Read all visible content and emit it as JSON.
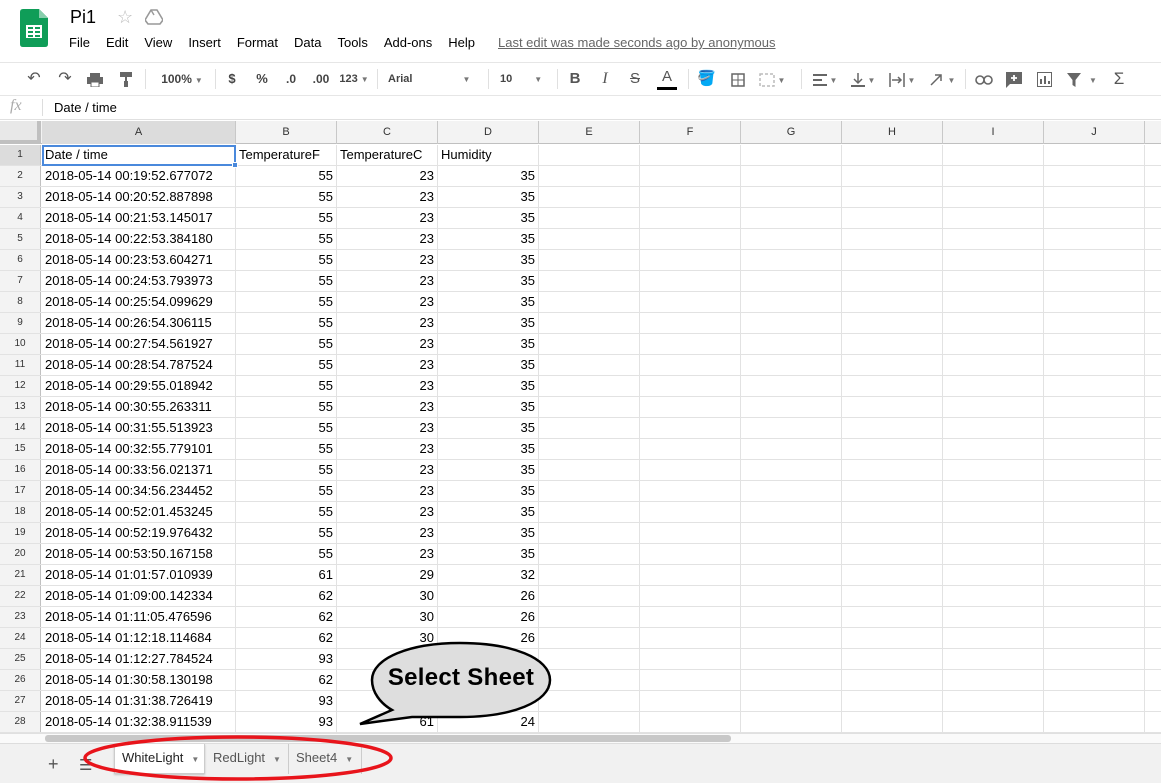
{
  "app": {
    "title": "Pi1",
    "last_edit": "Last edit was made seconds ago by anonymous"
  },
  "menu": [
    "File",
    "Edit",
    "View",
    "Insert",
    "Format",
    "Data",
    "Tools",
    "Add-ons",
    "Help"
  ],
  "toolbar": {
    "zoom": "100%",
    "currency": "$",
    "percent": "%",
    "dec_less": ".0",
    "dec_more": ".00",
    "format_more": "123",
    "font": "Arial",
    "font_size": "10",
    "bold": "B",
    "italic": "I",
    "strike": "S",
    "text_color": "A",
    "functions": "Σ"
  },
  "formula_bar": {
    "fx": "fx",
    "value": "Date / time"
  },
  "columns": [
    "A",
    "B",
    "C",
    "D",
    "E",
    "F",
    "G",
    "H",
    "I",
    "J"
  ],
  "rows": [
    {
      "n": "1",
      "a": "Date / time",
      "b": "TemperatureF",
      "c": "TemperatureC",
      "d": "Humidity"
    },
    {
      "n": "2",
      "a": "2018-05-14 00:19:52.677072",
      "b": "55",
      "c": "23",
      "d": "35"
    },
    {
      "n": "3",
      "a": "2018-05-14 00:20:52.887898",
      "b": "55",
      "c": "23",
      "d": "35"
    },
    {
      "n": "4",
      "a": "2018-05-14 00:21:53.145017",
      "b": "55",
      "c": "23",
      "d": "35"
    },
    {
      "n": "5",
      "a": "2018-05-14 00:22:53.384180",
      "b": "55",
      "c": "23",
      "d": "35"
    },
    {
      "n": "6",
      "a": "2018-05-14 00:23:53.604271",
      "b": "55",
      "c": "23",
      "d": "35"
    },
    {
      "n": "7",
      "a": "2018-05-14 00:24:53.793973",
      "b": "55",
      "c": "23",
      "d": "35"
    },
    {
      "n": "8",
      "a": "2018-05-14 00:25:54.099629",
      "b": "55",
      "c": "23",
      "d": "35"
    },
    {
      "n": "9",
      "a": "2018-05-14 00:26:54.306115",
      "b": "55",
      "c": "23",
      "d": "35"
    },
    {
      "n": "10",
      "a": "2018-05-14 00:27:54.561927",
      "b": "55",
      "c": "23",
      "d": "35"
    },
    {
      "n": "11",
      "a": "2018-05-14 00:28:54.787524",
      "b": "55",
      "c": "23",
      "d": "35"
    },
    {
      "n": "12",
      "a": "2018-05-14 00:29:55.018942",
      "b": "55",
      "c": "23",
      "d": "35"
    },
    {
      "n": "13",
      "a": "2018-05-14 00:30:55.263311",
      "b": "55",
      "c": "23",
      "d": "35"
    },
    {
      "n": "14",
      "a": "2018-05-14 00:31:55.513923",
      "b": "55",
      "c": "23",
      "d": "35"
    },
    {
      "n": "15",
      "a": "2018-05-14 00:32:55.779101",
      "b": "55",
      "c": "23",
      "d": "35"
    },
    {
      "n": "16",
      "a": "2018-05-14 00:33:56.021371",
      "b": "55",
      "c": "23",
      "d": "35"
    },
    {
      "n": "17",
      "a": "2018-05-14 00:34:56.234452",
      "b": "55",
      "c": "23",
      "d": "35"
    },
    {
      "n": "18",
      "a": "2018-05-14 00:52:01.453245",
      "b": "55",
      "c": "23",
      "d": "35"
    },
    {
      "n": "19",
      "a": "2018-05-14 00:52:19.976432",
      "b": "55",
      "c": "23",
      "d": "35"
    },
    {
      "n": "20",
      "a": "2018-05-14 00:53:50.167158",
      "b": "55",
      "c": "23",
      "d": "35"
    },
    {
      "n": "21",
      "a": "2018-05-14 01:01:57.010939",
      "b": "61",
      "c": "29",
      "d": "32"
    },
    {
      "n": "22",
      "a": "2018-05-14 01:09:00.142334",
      "b": "62",
      "c": "30",
      "d": "26"
    },
    {
      "n": "23",
      "a": "2018-05-14 01:11:05.476596",
      "b": "62",
      "c": "30",
      "d": "26"
    },
    {
      "n": "24",
      "a": "2018-05-14 01:12:18.114684",
      "b": "62",
      "c": "30",
      "d": "26"
    },
    {
      "n": "25",
      "a": "2018-05-14 01:12:27.784524",
      "b": "93",
      "c": "",
      "d": ""
    },
    {
      "n": "26",
      "a": "2018-05-14 01:30:58.130198",
      "b": "62",
      "c": "",
      "d": ""
    },
    {
      "n": "27",
      "a": "2018-05-14 01:31:38.726419",
      "b": "93",
      "c": "",
      "d": ""
    },
    {
      "n": "28",
      "a": "2018-05-14 01:32:38.911539",
      "b": "93",
      "c": "61",
      "d": "24"
    }
  ],
  "sheets": [
    "WhiteLight",
    "RedLight",
    "Sheet4"
  ],
  "annotation": {
    "callout": "Select Sheet",
    "highlight_color": "#e8141b"
  },
  "colors": {
    "selection": "#4a89dc",
    "sheets_green": "#0f9d58"
  }
}
